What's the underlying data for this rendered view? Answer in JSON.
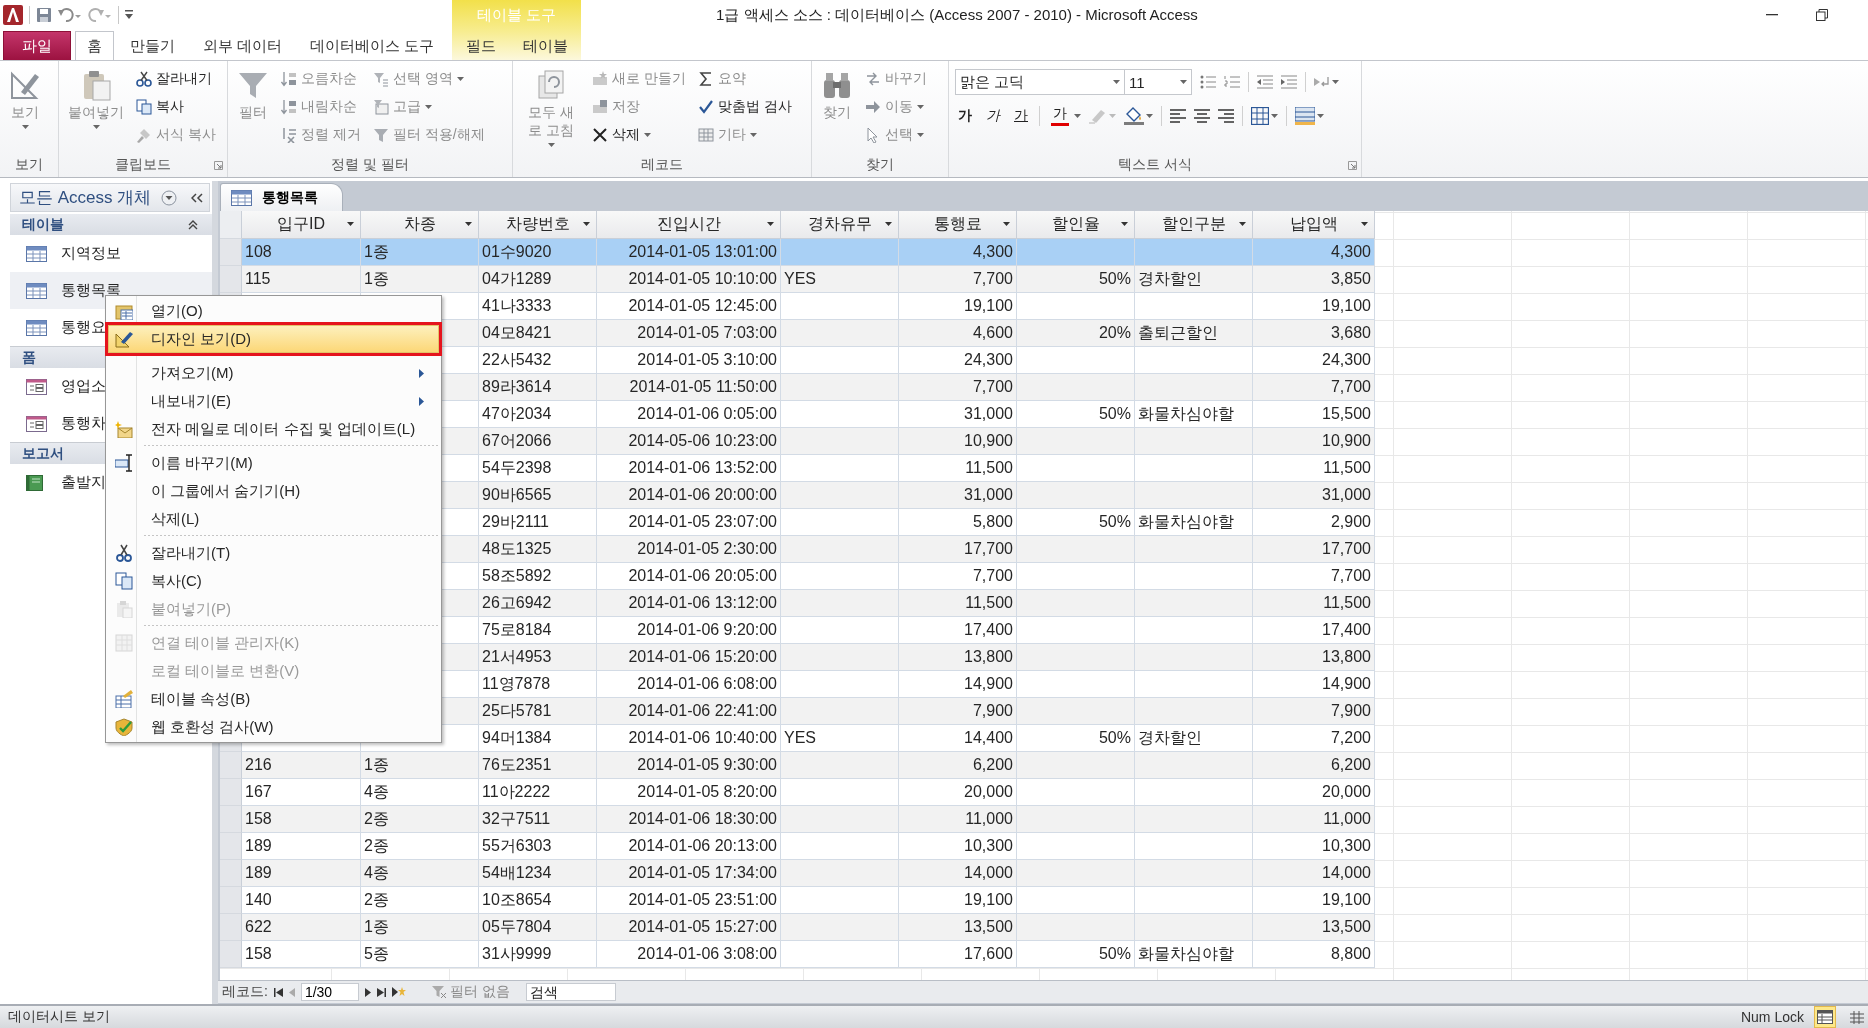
{
  "window": {
    "title": "1급 액세스 소스 : 데이터베이스 (Access 2007 - 2010)  -  Microsoft Access"
  },
  "ribbon": {
    "tabs": [
      {
        "label": "파일",
        "kind": "file",
        "selected": false
      },
      {
        "label": "홈",
        "kind": "normal",
        "selected": true
      },
      {
        "label": "만들기",
        "kind": "normal",
        "selected": false
      },
      {
        "label": "외부 데이터",
        "kind": "normal",
        "selected": false
      },
      {
        "label": "데이터베이스 도구",
        "kind": "normal",
        "selected": false
      }
    ],
    "context": {
      "label": "테이블 도구",
      "tabs": [
        {
          "label": "필드",
          "selected": false
        },
        {
          "label": "테이블",
          "selected": false
        }
      ]
    },
    "groups": [
      {
        "label": "보기",
        "kind": "buttons",
        "columns": [
          [
            {
              "kind": "large",
              "label": "보기",
              "dropdown": true,
              "disabled": true
            }
          ]
        ]
      },
      {
        "label": "클립보드",
        "kind": "buttons",
        "launcher": true,
        "columns": [
          [
            {
              "kind": "large",
              "label": "붙여넣기",
              "dropdown": true,
              "disabled": true
            }
          ],
          [
            {
              "kind": "small",
              "label": "잘라내기",
              "dropdown": false,
              "disabled": false
            },
            {
              "kind": "small",
              "label": "복사",
              "dropdown": false,
              "disabled": false
            },
            {
              "kind": "small",
              "label": "서식 복사",
              "dropdown": false,
              "disabled": true
            }
          ]
        ]
      },
      {
        "label": "정렬 및 필터",
        "kind": "buttons",
        "columns": [
          [
            {
              "kind": "large",
              "label": "필터",
              "dropdown": false,
              "disabled": true
            }
          ],
          [
            {
              "kind": "small",
              "label": "오름차순",
              "dropdown": false,
              "disabled": true
            },
            {
              "kind": "small",
              "label": "내림차순",
              "dropdown": false,
              "disabled": true
            },
            {
              "kind": "small",
              "label": "정렬 제거",
              "dropdown": false,
              "disabled": true
            }
          ],
          [
            {
              "kind": "small",
              "label": "선택 영역",
              "dropdown": true,
              "disabled": true
            },
            {
              "kind": "small",
              "label": "고급",
              "dropdown": true,
              "disabled": true
            },
            {
              "kind": "small",
              "label": "필터 적용/해제",
              "dropdown": false,
              "disabled": true
            }
          ]
        ]
      },
      {
        "label": "레코드",
        "kind": "buttons",
        "columns": [
          [
            {
              "kind": "large",
              "label": "모두 새로 고침",
              "dropdown": true,
              "disabled": true
            }
          ],
          [
            {
              "kind": "small",
              "label": "새로 만들기",
              "dropdown": false,
              "disabled": true
            },
            {
              "kind": "small",
              "label": "저장",
              "dropdown": false,
              "disabled": true
            },
            {
              "kind": "small",
              "label": "삭제",
              "dropdown": true,
              "disabled": false
            }
          ],
          [
            {
              "kind": "small",
              "label": "요약",
              "dropdown": false,
              "disabled": true
            },
            {
              "kind": "small",
              "label": "맞춤법 검사",
              "dropdown": false,
              "disabled": false
            },
            {
              "kind": "small",
              "label": "기타",
              "dropdown": true,
              "disabled": true
            }
          ]
        ]
      },
      {
        "label": "찾기",
        "kind": "buttons",
        "columns": [
          [
            {
              "kind": "large",
              "label": "찾기",
              "dropdown": false,
              "disabled": true
            }
          ],
          [
            {
              "kind": "small",
              "label": "바꾸기",
              "dropdown": false,
              "disabled": true
            },
            {
              "kind": "small",
              "label": "이동",
              "dropdown": true,
              "disabled": true
            },
            {
              "kind": "small",
              "label": "선택",
              "dropdown": true,
              "disabled": true
            }
          ]
        ]
      },
      {
        "label": "텍스트 서식",
        "kind": "format",
        "launcher": true,
        "font": "맑은 고딕",
        "size": "11",
        "styles": [
          {
            "label": "가",
            "kind": "bold"
          },
          {
            "label": "가",
            "kind": "italic"
          },
          {
            "label": "가",
            "kind": "underline"
          },
          {
            "label": "가",
            "kind": "color"
          }
        ]
      }
    ]
  },
  "nav": {
    "title": "모든 Access 개체",
    "sections": [
      {
        "label": "테이블",
        "kind": "table",
        "chevron": true,
        "items": [
          {
            "label": "지역정보",
            "selected": false
          },
          {
            "label": "통행목록",
            "selected": true
          },
          {
            "label": "통행요",
            "selected": false
          }
        ]
      },
      {
        "label": "폼",
        "kind": "form",
        "items": [
          {
            "label": "영업소",
            "selected": false
          },
          {
            "label": "통행차",
            "selected": false
          }
        ]
      },
      {
        "label": "보고서",
        "kind": "report",
        "items": [
          {
            "label": "출발지",
            "selected": false
          }
        ]
      }
    ]
  },
  "document": {
    "tabs": [
      {
        "label": "통행목록",
        "selected": true
      }
    ],
    "columns": [
      {
        "label": "입구ID",
        "kind": "text"
      },
      {
        "label": "차종",
        "kind": "text"
      },
      {
        "label": "차량번호",
        "kind": "text"
      },
      {
        "label": "진입시간",
        "kind": "datetime"
      },
      {
        "label": "경차유무",
        "kind": "text"
      },
      {
        "label": "통행료",
        "kind": "number"
      },
      {
        "label": "할인율",
        "kind": "number"
      },
      {
        "label": "할인구분",
        "kind": "text"
      },
      {
        "label": "납입액",
        "kind": "number"
      }
    ],
    "rows": [
      {
        "selected": true,
        "cells": [
          "108",
          "1종",
          "01수9020",
          "2014-01-05 13:01:00",
          null,
          "4,300",
          null,
          null,
          "4,300"
        ]
      },
      {
        "selected": false,
        "cells": [
          "115",
          "1종",
          "04가1289",
          "2014-01-05 10:10:00",
          "YES",
          "7,700",
          "50%",
          "경차할인",
          "3,850"
        ]
      },
      {
        "selected": false,
        "cells": [
          null,
          null,
          "41나3333",
          "2014-01-05 12:45:00",
          null,
          "19,100",
          null,
          null,
          "19,100"
        ]
      },
      {
        "selected": false,
        "cells": [
          null,
          null,
          "04모8421",
          "2014-01-05 7:03:00",
          null,
          "4,600",
          "20%",
          "출퇴근할인",
          "3,680"
        ]
      },
      {
        "selected": false,
        "cells": [
          null,
          null,
          "22사5432",
          "2014-01-05 3:10:00",
          null,
          "24,300",
          null,
          null,
          "24,300"
        ]
      },
      {
        "selected": false,
        "cells": [
          null,
          null,
          "89라3614",
          "2014-01-05 11:50:00",
          null,
          "7,700",
          null,
          null,
          "7,700"
        ]
      },
      {
        "selected": false,
        "cells": [
          null,
          null,
          "47아2034",
          "2014-01-06 0:05:00",
          null,
          "31,000",
          "50%",
          "화물차심야할",
          "15,500"
        ]
      },
      {
        "selected": false,
        "cells": [
          null,
          null,
          "67어2066",
          "2014-05-06 10:23:00",
          null,
          "10,900",
          null,
          null,
          "10,900"
        ]
      },
      {
        "selected": false,
        "cells": [
          null,
          null,
          "54두2398",
          "2014-01-06 13:52:00",
          null,
          "11,500",
          null,
          null,
          "11,500"
        ]
      },
      {
        "selected": false,
        "cells": [
          null,
          null,
          "90바6565",
          "2014-01-06 20:00:00",
          null,
          "31,000",
          null,
          null,
          "31,000"
        ]
      },
      {
        "selected": false,
        "cells": [
          null,
          null,
          "29바2111",
          "2014-01-05 23:07:00",
          null,
          "5,800",
          "50%",
          "화물차심야할",
          "2,900"
        ]
      },
      {
        "selected": false,
        "cells": [
          null,
          null,
          "48도1325",
          "2014-01-05 2:30:00",
          null,
          "17,700",
          null,
          null,
          "17,700"
        ]
      },
      {
        "selected": false,
        "cells": [
          null,
          null,
          "58조5892",
          "2014-01-06 20:05:00",
          null,
          "7,700",
          null,
          null,
          "7,700"
        ]
      },
      {
        "selected": false,
        "cells": [
          null,
          null,
          "26고6942",
          "2014-01-06 13:12:00",
          null,
          "11,500",
          null,
          null,
          "11,500"
        ]
      },
      {
        "selected": false,
        "cells": [
          null,
          null,
          "75로8184",
          "2014-01-06 9:20:00",
          null,
          "17,400",
          null,
          null,
          "17,400"
        ]
      },
      {
        "selected": false,
        "cells": [
          null,
          null,
          "21서4953",
          "2014-01-06 15:20:00",
          null,
          "13,800",
          null,
          null,
          "13,800"
        ]
      },
      {
        "selected": false,
        "cells": [
          null,
          null,
          "11영7878",
          "2014-01-06 6:08:00",
          null,
          "14,900",
          null,
          null,
          "14,900"
        ]
      },
      {
        "selected": false,
        "cells": [
          null,
          null,
          "25다5781",
          "2014-01-06 22:41:00",
          null,
          "7,900",
          null,
          null,
          "7,900"
        ]
      },
      {
        "selected": false,
        "cells": [
          null,
          null,
          "94머1384",
          "2014-01-06 10:40:00",
          "YES",
          "14,400",
          "50%",
          "경차할인",
          "7,200"
        ]
      },
      {
        "selected": false,
        "cells": [
          "216",
          "1종",
          "76도2351",
          "2014-01-05 9:30:00",
          null,
          "6,200",
          null,
          null,
          "6,200"
        ]
      },
      {
        "selected": false,
        "cells": [
          "167",
          "4종",
          "11아2222",
          "2014-01-05 8:20:00",
          null,
          "20,000",
          null,
          null,
          "20,000"
        ]
      },
      {
        "selected": false,
        "cells": [
          "158",
          "2종",
          "32구7511",
          "2014-01-06 18:30:00",
          null,
          "11,000",
          null,
          null,
          "11,000"
        ]
      },
      {
        "selected": false,
        "cells": [
          "189",
          "2종",
          "55거6303",
          "2014-01-06 20:13:00",
          null,
          "10,300",
          null,
          null,
          "10,300"
        ]
      },
      {
        "selected": false,
        "cells": [
          "189",
          "4종",
          "54배1234",
          "2014-01-05 17:34:00",
          null,
          "14,000",
          null,
          null,
          "14,000"
        ]
      },
      {
        "selected": false,
        "cells": [
          "140",
          "2종",
          "10조8654",
          "2014-01-05 23:51:00",
          null,
          "19,100",
          null,
          null,
          "19,100"
        ]
      },
      {
        "selected": false,
        "cells": [
          "622",
          "1종",
          "05두7804",
          "2014-01-05 15:27:00",
          null,
          "13,500",
          null,
          null,
          "13,500"
        ]
      },
      {
        "selected": false,
        "cells": [
          "158",
          "5종",
          "31사9999",
          "2014-01-06 3:08:00",
          null,
          "17,600",
          "50%",
          "화물차심야할",
          "8,800"
        ]
      }
    ],
    "record_nav": {
      "label": "레코드:",
      "position": "1/30",
      "filter": "필터 없음",
      "search": {
        "placeholder": "검색"
      }
    }
  },
  "context_menu": {
    "items": [
      {
        "kind": "item",
        "label": "열기(O)",
        "selected": false,
        "outlined": false,
        "disabled": false,
        "submenu": false
      },
      {
        "kind": "item",
        "label": "디자인 보기(D)",
        "selected": true,
        "outlined": true,
        "disabled": false,
        "submenu": false
      },
      {
        "kind": "separator"
      },
      {
        "kind": "item",
        "label": "가져오기(M)",
        "selected": false,
        "outlined": false,
        "disabled": false,
        "submenu": true
      },
      {
        "kind": "item",
        "label": "내보내기(E)",
        "selected": false,
        "outlined": false,
        "disabled": false,
        "submenu": true
      },
      {
        "kind": "item",
        "label": "전자 메일로 데이터 수집 및 업데이트(L)",
        "selected": false,
        "outlined": false,
        "disabled": false,
        "submenu": false
      },
      {
        "kind": "separator"
      },
      {
        "kind": "item",
        "label": "이름 바꾸기(M)",
        "selected": false,
        "outlined": false,
        "disabled": false,
        "submenu": false
      },
      {
        "kind": "item",
        "label": "이 그룹에서 숨기기(H)",
        "selected": false,
        "outlined": false,
        "disabled": false,
        "submenu": false
      },
      {
        "kind": "item",
        "label": "삭제(L)",
        "selected": false,
        "outlined": false,
        "disabled": false,
        "submenu": false
      },
      {
        "kind": "separator"
      },
      {
        "kind": "item",
        "label": "잘라내기(T)",
        "selected": false,
        "outlined": false,
        "disabled": false,
        "submenu": false
      },
      {
        "kind": "item",
        "label": "복사(C)",
        "selected": false,
        "outlined": false,
        "disabled": false,
        "submenu": false
      },
      {
        "kind": "item",
        "label": "붙여넣기(P)",
        "selected": false,
        "outlined": false,
        "disabled": true,
        "submenu": false
      },
      {
        "kind": "separator"
      },
      {
        "kind": "item",
        "label": "연결 테이블 관리자(K)",
        "selected": false,
        "outlined": false,
        "disabled": true,
        "submenu": false
      },
      {
        "kind": "item",
        "label": "로컬 테이블로 변환(V)",
        "selected": false,
        "outlined": false,
        "disabled": true,
        "submenu": false
      },
      {
        "kind": "item",
        "label": "테이블 속성(B)",
        "selected": false,
        "outlined": false,
        "disabled": false,
        "submenu": false
      },
      {
        "kind": "item",
        "label": "웹 호환성 검사(W)",
        "selected": false,
        "outlined": false,
        "disabled": false,
        "submenu": false
      }
    ]
  },
  "status_bar": {
    "left": "데이터시트 보기",
    "right": "Num Lock",
    "views": [
      {
        "selected": true
      },
      {
        "selected": false
      }
    ]
  }
}
